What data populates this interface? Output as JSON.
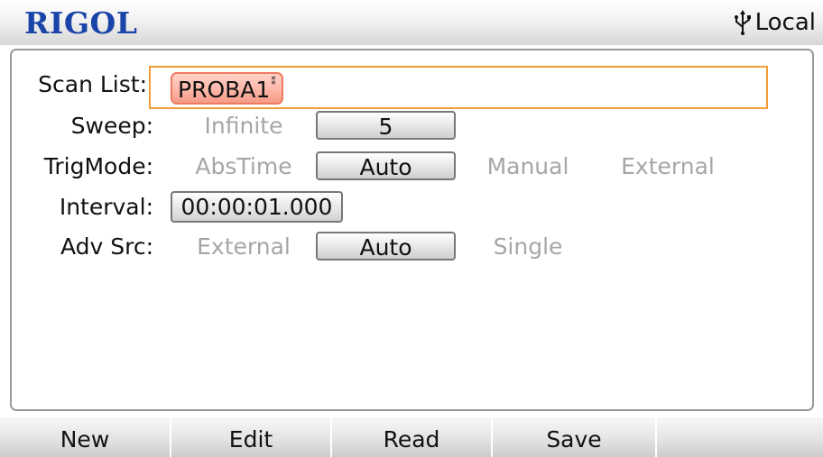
{
  "header": {
    "logo": "RIGOL",
    "status_icon": "usb-icon",
    "status_text": "Local"
  },
  "scan_list": {
    "label": "Scan List:",
    "value": "PROBA1",
    "cursor_mark": "⁑"
  },
  "sweep": {
    "label": "Sweep:",
    "options": [
      "Infinite",
      "5"
    ],
    "selected": "5"
  },
  "trig_mode": {
    "label": "TrigMode:",
    "options": [
      "AbsTime",
      "Auto",
      "Manual",
      "External"
    ],
    "selected": "Auto"
  },
  "interval": {
    "label": "Interval:",
    "value": "00:00:01.000"
  },
  "adv_src": {
    "label": "Adv Src:",
    "options": [
      "External",
      "Auto",
      "Single"
    ],
    "selected": "Auto"
  },
  "softkeys": [
    "New",
    "Edit",
    "Read",
    "Save",
    ""
  ],
  "colors": {
    "logo": "#1a44a8",
    "focus_border": "#f29c3a",
    "scan_value_bg": "#fdb7a8",
    "inactive_text": "#a6a6a6"
  }
}
